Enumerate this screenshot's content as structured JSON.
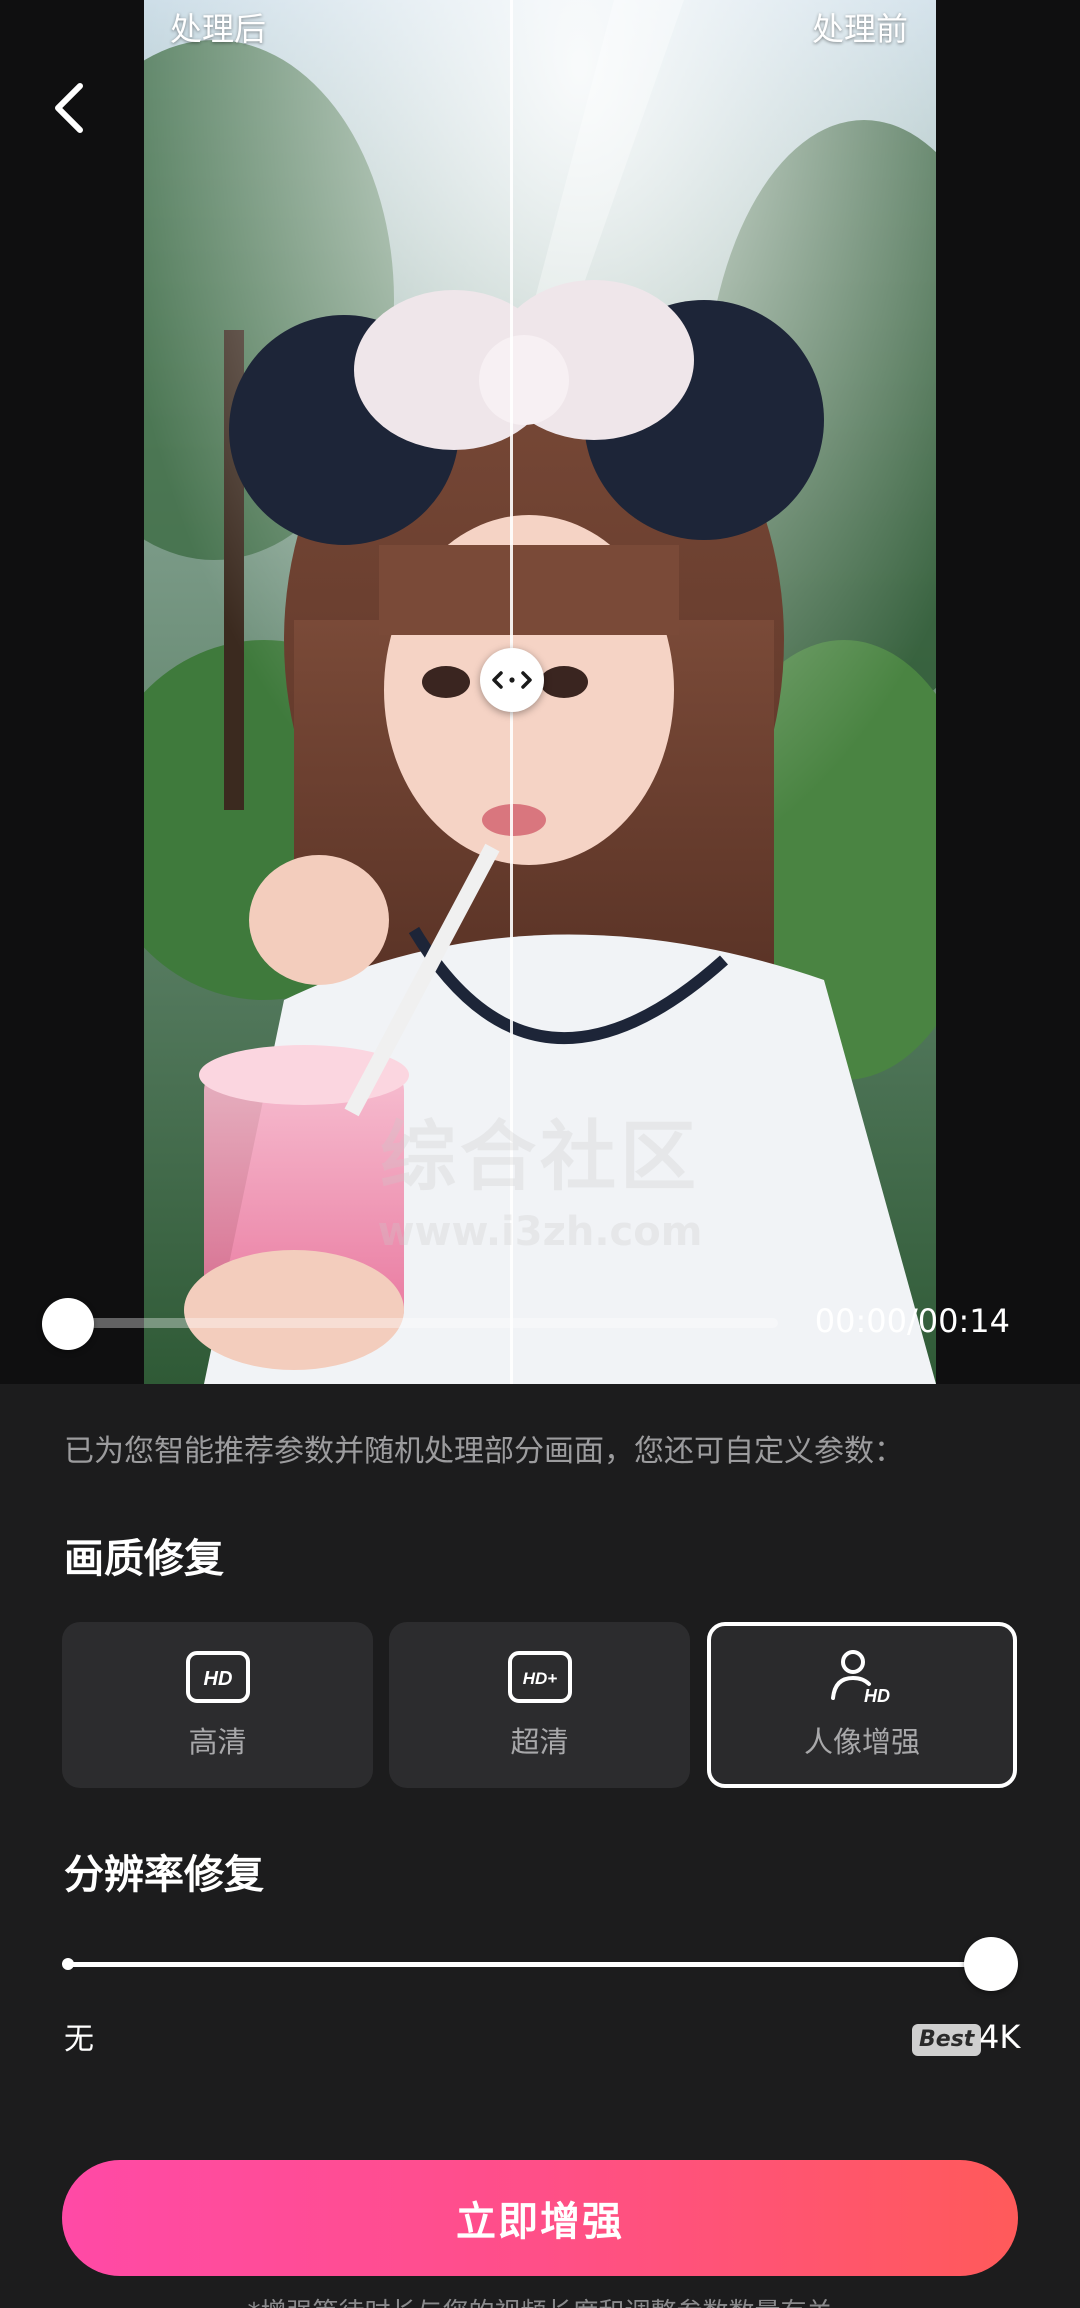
{
  "preview": {
    "label_after": "处理后",
    "label_before": "处理前",
    "watermark_title": "综合社区",
    "watermark_url": "www.i3zh.com",
    "time": "00:00/00:14",
    "playback_progress": 0.0
  },
  "hint": "已为您智能推荐参数并随机处理部分画面，您还可自定义参数：",
  "quality": {
    "title": "画质修复",
    "options": [
      {
        "label": "高清",
        "icon": "hd-icon",
        "selected": false
      },
      {
        "label": "超清",
        "icon": "hd-plus-icon",
        "selected": false
      },
      {
        "label": "人像增强",
        "icon": "portrait-hd-icon",
        "selected": true
      }
    ]
  },
  "resolution": {
    "title": "分辨率修复",
    "min_label": "无",
    "badge": "Best",
    "max_label": "4K",
    "value": 1.0
  },
  "cta": {
    "label": "立即增强"
  },
  "footnote": "*增强等待时长与您的视频长度和调整参数数量有关",
  "colors": {
    "background": "#1c1c1d",
    "card": "#2c2c2e",
    "cta_start": "#ff4aa6",
    "cta_end": "#ff5a5a"
  }
}
